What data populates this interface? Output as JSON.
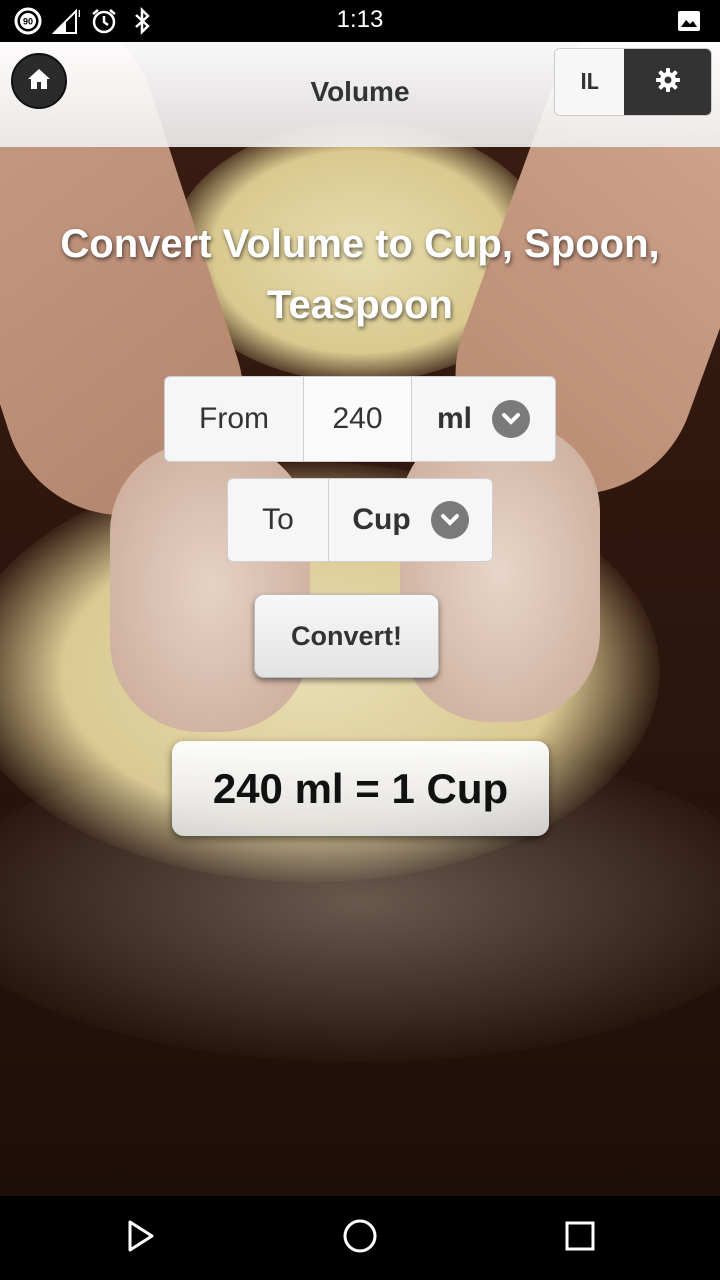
{
  "status_bar": {
    "time": "1:13",
    "badge": "90",
    "network": "H",
    "icons": [
      "data-saver-icon",
      "signal-icon",
      "alarm-icon",
      "bluetooth-icon",
      "image-notification-icon"
    ]
  },
  "header": {
    "title": "Volume",
    "lang_label": "IL",
    "icons": {
      "home": "home-icon",
      "settings": "gear-icon"
    }
  },
  "main": {
    "title": "Convert Volume to Cup, Spoon, Teaspoon",
    "from": {
      "label": "From",
      "value": "240",
      "unit": "ml"
    },
    "to": {
      "label": "To",
      "unit": "Cup"
    },
    "convert_label": "Convert!",
    "result": "240 ml = 1 Cup"
  },
  "nav_bar": {
    "icons": [
      "back-icon",
      "home-circle-icon",
      "recents-icon"
    ]
  },
  "colors": {
    "header_bg": "#f3f3f3",
    "dark_button": "#333333",
    "chevron": "#7a7a7a",
    "wood": "#2a140c"
  }
}
